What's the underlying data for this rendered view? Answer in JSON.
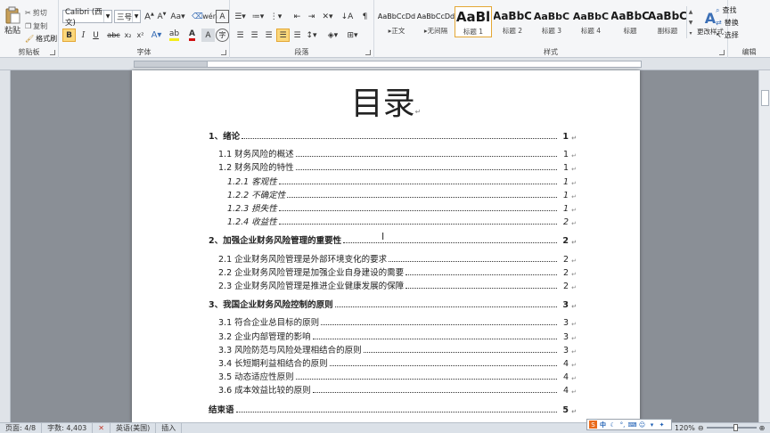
{
  "ribbon": {
    "clipboard": {
      "group_label": "剪贴板",
      "paste_label": "粘贴",
      "cut_label": "剪切",
      "copy_label": "复制",
      "format_painter_label": "格式刷"
    },
    "font": {
      "group_label": "字体",
      "font_name": "Calibri (西文)",
      "font_size": "三号"
    },
    "paragraph": {
      "group_label": "段落"
    },
    "styles": {
      "group_label": "样式",
      "items": [
        {
          "sample": "AaBbCcDd",
          "name": "正文"
        },
        {
          "sample": "AaBbCcDd",
          "name": "无间隔"
        },
        {
          "sample": "AaBl",
          "name": "标题 1"
        },
        {
          "sample": "AaBbC",
          "name": "标题 2"
        },
        {
          "sample": "AaBbC",
          "name": "标题 3"
        },
        {
          "sample": "AaBbC",
          "name": "标题 4"
        },
        {
          "sample": "AaBbC",
          "name": "标题"
        },
        {
          "sample": "AaBbC",
          "name": "副标题"
        }
      ],
      "change_styles_label": "更改样式"
    },
    "editing": {
      "group_label": "编辑",
      "find_label": "查找",
      "replace_label": "替换",
      "select_label": "选择"
    }
  },
  "document": {
    "title": "目录",
    "toc": [
      {
        "level": 1,
        "label": "1、绪论",
        "page": "1"
      },
      {
        "level": 2,
        "label": "1.1 财务风险的概述",
        "page": "1"
      },
      {
        "level": 2,
        "label": "1.2 财务风险的特性",
        "page": "1"
      },
      {
        "level": 3,
        "label": "1.2.1 客观性",
        "page": "1"
      },
      {
        "level": 3,
        "label": "1.2.2 不确定性",
        "page": "1"
      },
      {
        "level": 3,
        "label": "1.2.3 损失性",
        "page": "1"
      },
      {
        "level": 3,
        "label": "1.2.4 收益性",
        "page": "2"
      },
      {
        "level": 1,
        "label": "2、加强企业财务风险管理的重要性",
        "page": "2"
      },
      {
        "level": 2,
        "label": "2.1 企业财务风险管理是外部环境变化的要求",
        "page": "2"
      },
      {
        "level": 2,
        "label": "2.2 企业财务风险管理是加强企业自身建设的需要",
        "page": "2"
      },
      {
        "level": 2,
        "label": "2.3 企业财务风险管理是推进企业健康发展的保障",
        "page": "2"
      },
      {
        "level": 1,
        "label": "3、我国企业财务风险控制的原则",
        "page": "3"
      },
      {
        "level": 2,
        "label": "3.1 符合企业总目标的原则",
        "page": "3"
      },
      {
        "level": 2,
        "label": "3.2 企业内部管理的影响",
        "page": "3"
      },
      {
        "level": 2,
        "label": "3.3 风险防范与风险处理相结合的原则",
        "page": "3"
      },
      {
        "level": 2,
        "label": "3.4 长短期利益相结合的原则",
        "page": "4"
      },
      {
        "level": 2,
        "label": "3.5 动态适应性原则",
        "page": "4"
      },
      {
        "level": 2,
        "label": "3.6 成本效益比较的原则",
        "page": "4"
      },
      {
        "level": 1,
        "label": "结束语",
        "page": "5"
      }
    ]
  },
  "status_bar": {
    "page": "页面: 4/8",
    "words": "字数: 4,403",
    "language": "英语(美国)",
    "mode": "插入",
    "zoom": "120%",
    "ime_label": "中"
  },
  "colors": {
    "accent": "#e4a735",
    "font_color": "#d01010",
    "highlight": "#f4ec1a"
  }
}
